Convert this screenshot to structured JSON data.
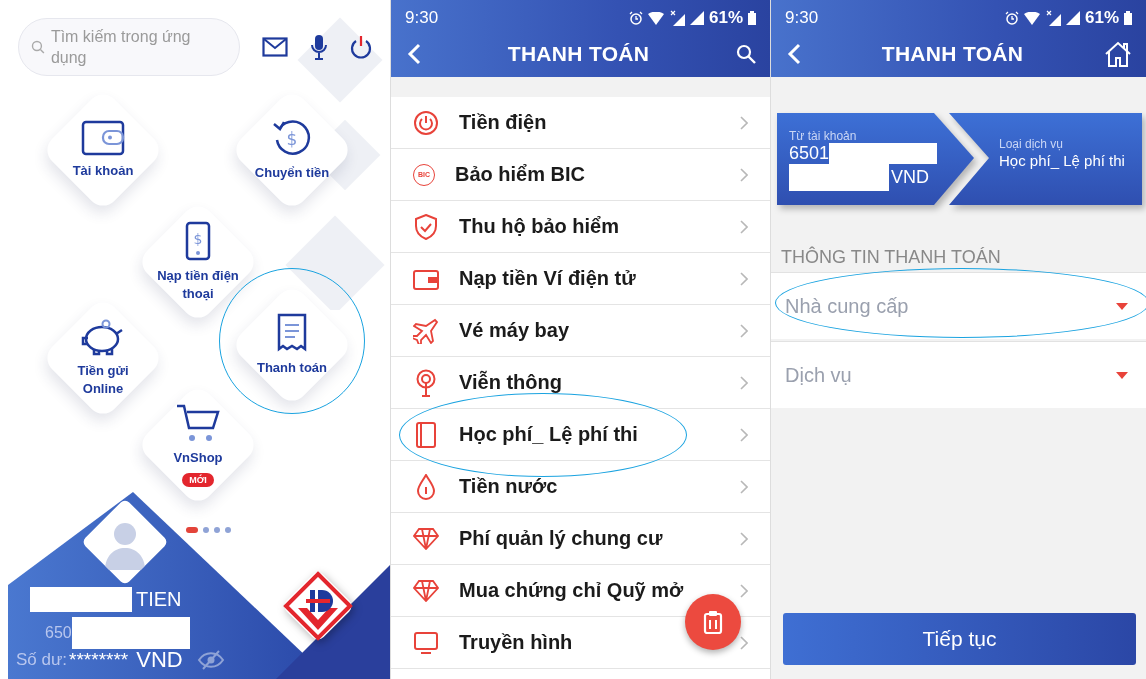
{
  "home_screen": {
    "search": {
      "placeholder": "Tìm kiếm trong ứng dụng"
    },
    "tiles": [
      {
        "label": "Tài khoản",
        "kind": "wallet",
        "circled": false
      },
      {
        "label": "Chuyển tiền",
        "kind": "transfer",
        "circled": false,
        "icon_text": "$"
      },
      {
        "label": "Nạp tiền điện thoại",
        "kind": "phone",
        "circled": false,
        "icon_text": "$"
      },
      {
        "label": "Tiền gửi Online",
        "kind": "piggy",
        "circled": false
      },
      {
        "label": "Thanh toán",
        "kind": "receipt",
        "circled": true
      },
      {
        "label": "VnShop",
        "kind": "cart",
        "circled": false,
        "badge": "MỚI"
      }
    ],
    "page_dots": [
      {
        "selected": true
      },
      {
        "selected": false
      },
      {
        "selected": false
      },
      {
        "selected": false
      }
    ],
    "account_card": {
      "name": "TIEN",
      "account": "650",
      "balance_label": "Số dư:",
      "balance": "********",
      "currency": "VND"
    }
  },
  "payment_menu": {
    "status_bar": {
      "time": "9:30",
      "battery": "61%"
    },
    "title": "THANH TOÁN",
    "items": [
      {
        "label": "Tiền điện",
        "kind": "power",
        "circled": false
      },
      {
        "label": "Bảo hiểm BIC",
        "kind": "bic",
        "circled": false,
        "icon_text": "BIC"
      },
      {
        "label": "Thu hộ bảo hiểm",
        "kind": "shield",
        "circled": false
      },
      {
        "label": "Nạp tiền Ví điện tử",
        "kind": "wallet",
        "circled": false
      },
      {
        "label": "Vé máy bay",
        "kind": "plane",
        "circled": false
      },
      {
        "label": "Viễn thông",
        "kind": "signal",
        "circled": false
      },
      {
        "label": "Học phí_ Lệ phí thi",
        "kind": "book",
        "circled": true
      },
      {
        "label": "Tiền nước",
        "kind": "drop",
        "circled": false
      },
      {
        "label": "Phí quản lý chung cư",
        "kind": "diamond",
        "circled": false
      },
      {
        "label": "Mua chứng chỉ Quỹ mở",
        "kind": "diamond",
        "circled": false
      },
      {
        "label": "Truyền hình",
        "kind": "tv",
        "circled": false
      }
    ]
  },
  "payment_form": {
    "status_bar": {
      "time": "9:30",
      "battery": "61%"
    },
    "title": "THANH TOÁN",
    "from_label": "Từ tài khoản",
    "account": "6501",
    "currency": "VND",
    "service_label": "Loại dịch vụ",
    "service": "Học phí_ Lệ phí thi",
    "section_title": "THÔNG TIN THANH TOÁN",
    "fields": [
      {
        "placeholder": "Nhà cung cấp",
        "circled": true
      },
      {
        "placeholder": "Dịch vụ",
        "circled": false
      }
    ],
    "button": "Tiếp tục"
  }
}
